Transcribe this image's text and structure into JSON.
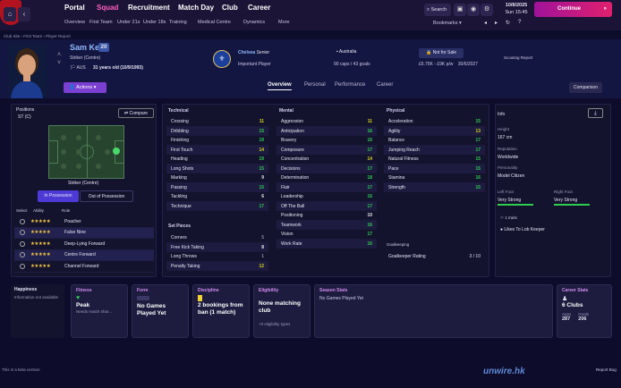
{
  "topbar": {
    "main_tabs": [
      "Portal",
      "Squad",
      "Recruitment",
      "Match Day",
      "Club",
      "Career"
    ],
    "sub_tabs": [
      "Overview",
      "First Team",
      "Under 21s",
      "Under 18s",
      "Training",
      "Medical Centre",
      "Dynamics",
      "More"
    ],
    "search_label": "Search",
    "date": "10/8/2025",
    "day": "Sun",
    "time": "15:45",
    "continue_label": "Continue",
    "bookmarks_label": "Bookmarks"
  },
  "breadcrumb": "Club Site › First Team › Player Report",
  "player": {
    "name": "Sam Kerr",
    "number": "20",
    "position": "Striker (Centre)",
    "nation": "AUS",
    "age": "31 years old (10/9/1993)",
    "club": "Chelsea",
    "club_level": "Senior",
    "status": "Important Player",
    "country": "Australia",
    "caps": "90 caps / 43 goals",
    "sale_status": "Not for Sale",
    "value": "£6.75K - £9K p/w",
    "contract": "30/6/2027",
    "scouting": "Scouting Report",
    "actions_label": "Actions"
  },
  "tabs": [
    "Overview",
    "Personal",
    "Performance",
    "Career"
  ],
  "comparison_label": "Comparison",
  "positions": {
    "title": "Positions",
    "value": "ST (C)",
    "compare_label": "Compare",
    "role_caption": "Striker (Centre)",
    "in_possession": "In Possession",
    "out_of_possession": "Out of Possession",
    "col_select": "Select",
    "col_ability": "Ability",
    "col_role": "Role",
    "roles": [
      "Poacher",
      "False Nine",
      "Deep-Lying Forward",
      "Centre Forward",
      "Channel Forward"
    ]
  },
  "technical": {
    "title": "Technical",
    "attrs": [
      {
        "name": "Crossing",
        "value": "11"
      },
      {
        "name": "Dribbling",
        "value": "15"
      },
      {
        "name": "Finishing",
        "value": "19"
      },
      {
        "name": "First Touch",
        "value": "14"
      },
      {
        "name": "Heading",
        "value": "19"
      },
      {
        "name": "Long Shots",
        "value": "15"
      },
      {
        "name": "Marking",
        "value": "9"
      },
      {
        "name": "Passing",
        "value": "15"
      },
      {
        "name": "Tackling",
        "value": "6"
      },
      {
        "name": "Technique",
        "value": "17"
      }
    ]
  },
  "set_pieces": {
    "title": "Set Pieces",
    "attrs": [
      {
        "name": "Corners",
        "value": "5"
      },
      {
        "name": "Free Kick Taking",
        "value": "8"
      },
      {
        "name": "Long Throws",
        "value": "1"
      },
      {
        "name": "Penalty Taking",
        "value": "12"
      }
    ]
  },
  "mental": {
    "title": "Mental",
    "attrs": [
      {
        "name": "Aggression",
        "value": "11"
      },
      {
        "name": "Anticipation",
        "value": "16"
      },
      {
        "name": "Bravery",
        "value": "16"
      },
      {
        "name": "Composure",
        "value": "17"
      },
      {
        "name": "Concentration",
        "value": "14"
      },
      {
        "name": "Decisions",
        "value": "17"
      },
      {
        "name": "Determination",
        "value": "18"
      },
      {
        "name": "Flair",
        "value": "17"
      },
      {
        "name": "Leadership",
        "value": "16"
      },
      {
        "name": "Off The Ball",
        "value": "17"
      },
      {
        "name": "Positioning",
        "value": "10"
      },
      {
        "name": "Teamwork",
        "value": "16"
      },
      {
        "name": "Vision",
        "value": "17"
      },
      {
        "name": "Work Rate",
        "value": "16"
      }
    ]
  },
  "physical": {
    "title": "Physical",
    "attrs": [
      {
        "name": "Acceleration",
        "value": "15"
      },
      {
        "name": "Agility",
        "value": "13"
      },
      {
        "name": "Balance",
        "value": "17"
      },
      {
        "name": "Jumping Reach",
        "value": "17"
      },
      {
        "name": "Natural Fitness",
        "value": "15"
      },
      {
        "name": "Pace",
        "value": "15"
      },
      {
        "name": "Stamina",
        "value": "16"
      },
      {
        "name": "Strength",
        "value": "15"
      }
    ]
  },
  "goalkeeping": {
    "title": "Goalkeeping",
    "label": "Goalkeeper Rating",
    "value": "3 / 10"
  },
  "info": {
    "title": "Info",
    "height_label": "Height",
    "height": "167 cm",
    "reputation_label": "Reputation",
    "reputation": "Worldwide",
    "personality_label": "Personality",
    "personality": "Model Citizen",
    "left_foot_label": "Left Foot",
    "left_foot": "Very Strong",
    "right_foot_label": "Right Foot",
    "right_foot": "Very Strong",
    "traits_label": "1 traits",
    "trait": "Likes To Lob Keeper"
  },
  "cards": {
    "happiness_title": "Happiness",
    "happiness_text": "Information not available",
    "fitness_title": "Fitness",
    "fitness_value": "Peak",
    "fitness_sub": "Needs match shar...",
    "form_title": "Form",
    "form_value": "No Games Played Yet",
    "discipline_title": "Discipline",
    "discipline_value": "2 bookings from ban (1 match)",
    "eligibility_title": "Eligibility",
    "eligibility_value": "None matching club",
    "eligibility_sub": "+0 eligibility types",
    "season_title": "Season Stats",
    "season_value": "No Games Played Yet",
    "career_title": "Career Stats",
    "career_value": "6 Clubs",
    "apps_label": "Apps",
    "apps": "287",
    "goals_label": "Goals",
    "goals": "206"
  },
  "footer": {
    "beta": "This is a beta version",
    "report_bug": "Report Bug"
  },
  "watermark": "unwire.hk",
  "colors": {
    "accent": "#e0206e",
    "high": "#2ecc4f",
    "mid": "#d6d21c",
    "low": "#8e8aa8"
  }
}
